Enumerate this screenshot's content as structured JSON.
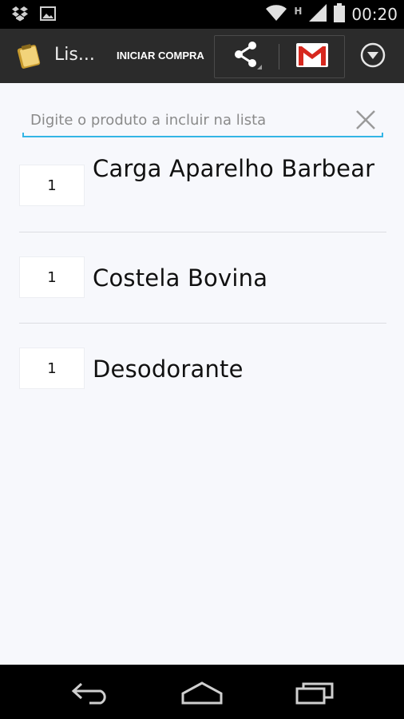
{
  "status_bar": {
    "time": "00:20",
    "network_label": "H",
    "icons": [
      "dropbox-icon",
      "image-icon",
      "wifi-icon",
      "signal-icon",
      "battery-icon"
    ]
  },
  "action_bar": {
    "title": "Lis...",
    "start_button_label": "INICIAR COMPRA",
    "icons": [
      "app-icon",
      "share-icon",
      "gmail-icon",
      "overflow-menu-icon"
    ]
  },
  "search": {
    "placeholder": "Digite o produto a incluir na lista",
    "value": ""
  },
  "items": [
    {
      "qty": "1",
      "name": "Carga Aparelho Barbear"
    },
    {
      "qty": "1",
      "name": "Costela Bovina"
    },
    {
      "qty": "1",
      "name": "Desodorante"
    }
  ],
  "nav_bar": {
    "icons": [
      "back-icon",
      "home-icon",
      "recents-icon"
    ]
  },
  "colors": {
    "accent": "#33b5e5",
    "action_bar": "#2b2b2b",
    "background": "#f7f8fc"
  }
}
